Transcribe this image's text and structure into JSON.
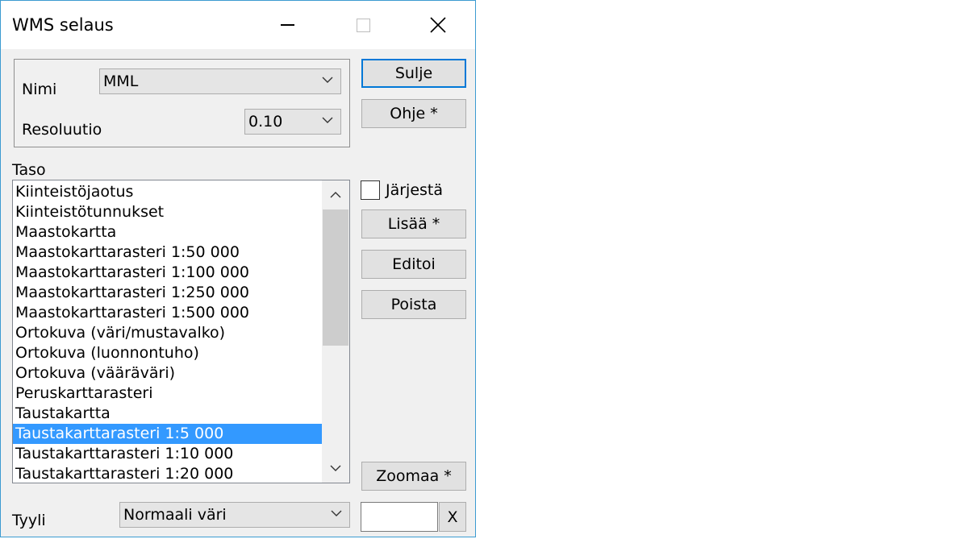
{
  "window": {
    "title": "WMS selaus",
    "controls": [
      "minimize-icon",
      "maximize-icon",
      "close-icon"
    ]
  },
  "settings": {
    "name_label": "Nimi",
    "name_value": "MML",
    "resolution_label": "Resoluutio",
    "resolution_value": "0.10"
  },
  "buttons": {
    "close": "Sulje",
    "help": "Ohje *",
    "add": "Lisää *",
    "edit": "Editoi",
    "delete": "Poista",
    "zoom": "Zoomaa *",
    "clear": "X"
  },
  "sort": {
    "label": "Järjestä",
    "checked": false
  },
  "layers": {
    "label": "Taso",
    "items": [
      "Kiinteistöjaotus",
      "Kiinteistötunnukset",
      "Maastokartta",
      "Maastokarttarasteri 1:50 000",
      "Maastokarttarasteri 1:100 000",
      "Maastokarttarasteri 1:250 000",
      "Maastokarttarasteri 1:500 000",
      "Ortokuva (väri/mustavalko)",
      "Ortokuva (luonnontuho)",
      "Ortokuva (vääräväri)",
      "Peruskarttarasteri",
      "Taustakartta",
      "Taustakarttarasteri 1:5 000",
      "Taustakarttarasteri 1:10 000",
      "Taustakarttarasteri 1:20 000"
    ],
    "selected": "Taustakarttarasteri 1:5 000"
  },
  "style": {
    "label": "Tyyli",
    "value": "Normaali väri"
  },
  "zoom_input": {
    "value": ""
  },
  "colors": {
    "accent": "#0078d7",
    "selection": "#3399ff",
    "window_border": "#3c9bd1",
    "dialog_bg": "#f0f0f0"
  }
}
